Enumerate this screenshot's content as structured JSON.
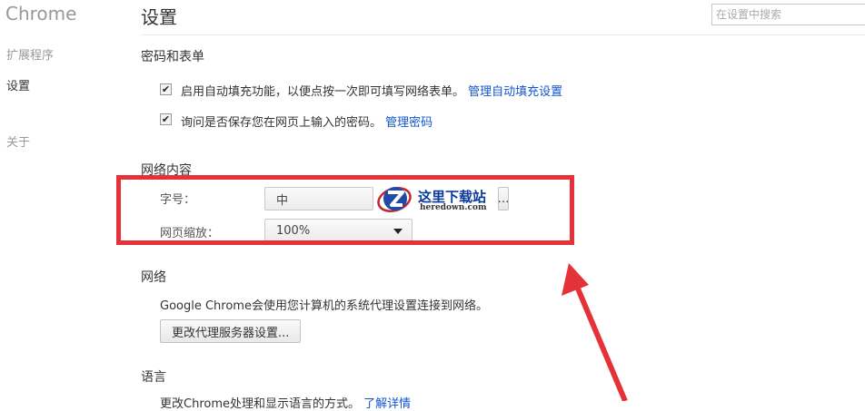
{
  "sidebar": {
    "title": "Chrome",
    "items": [
      {
        "label": "扩展程序"
      },
      {
        "label": "设置"
      },
      {
        "label": "关于"
      }
    ]
  },
  "header": {
    "title": "设置",
    "search_placeholder": "在设置中搜索"
  },
  "passwords": {
    "title": "密码和表单",
    "autofill_text": "启用自动填充功能，以便点按一次即可填写网络表单。",
    "autofill_link": "管理自动填充设置",
    "autofill_checked": true,
    "save_pw_text": "询问是否保存您在网页上输入的密码。",
    "save_pw_link": "管理密码",
    "save_pw_checked": true
  },
  "web_content": {
    "title": "网络内容",
    "font_size_label": "字号：",
    "font_size_value": "中",
    "font_button_fragment": "…",
    "zoom_label": "网页缩放：",
    "zoom_value": "100%"
  },
  "network": {
    "title": "网络",
    "description": "Google Chrome会使用您计算机的系统代理设置连接到网络。",
    "proxy_button": "更改代理服务器设置..."
  },
  "language": {
    "title": "语言",
    "description": "更改Chrome处理和显示语言的方式。",
    "link": "了解详情"
  },
  "watermark": {
    "name": "这里下载站",
    "url": "heredown.com"
  },
  "colors": {
    "highlight": "#e53238",
    "link": "#1155cc"
  }
}
